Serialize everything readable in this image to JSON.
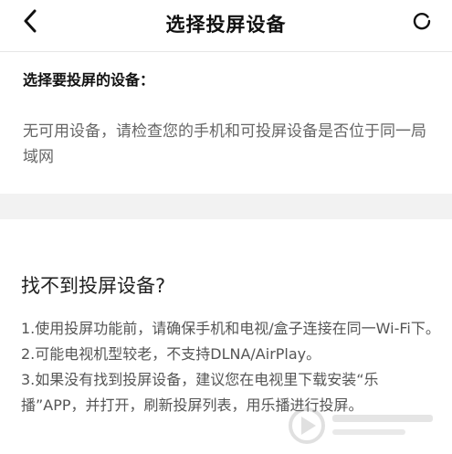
{
  "header": {
    "title": "选择投屏设备",
    "back_icon": "chevron-left-icon",
    "refresh_icon": "refresh-icon"
  },
  "devices": {
    "section_label": "选择要投屏的设备：",
    "empty_message": "无可用设备，请检查您的手机和可投屏设备是否位于同一局域网"
  },
  "help": {
    "title": "找不到投屏设备?",
    "items": [
      "1.使用投屏功能前，请确保手机和电视/盒子连接在同一Wi-Fi下。",
      "2.可能电视机型较老，不支持DLNA/AirPlay。",
      "3.如果没有找到投屏设备，建议您在电视里下载安装“乐播”APP，并打开，刷新投屏列表，用乐播进行投屏。"
    ]
  }
}
